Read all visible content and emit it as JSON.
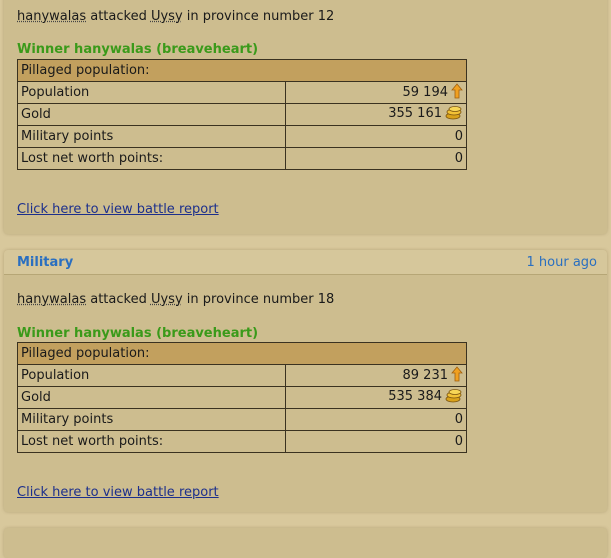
{
  "reports": [
    {
      "category": "",
      "time": "",
      "attacker": "hanywalas",
      "verb": "attacked",
      "defender": "Uysy",
      "province_text": "in province number 12",
      "winner": "Winner hanywalas (breaveheart)",
      "table_header": "Pillaged population:",
      "rows": [
        {
          "label": "Population",
          "value": "59 194",
          "icon": "population-arrow-icon"
        },
        {
          "label": "Gold",
          "value": "355 161",
          "icon": "gold-coins-icon"
        },
        {
          "label": "Military points",
          "value": "0"
        },
        {
          "label": "Lost net worth points:",
          "value": "0"
        }
      ],
      "link": "Click here to view battle report"
    },
    {
      "category": "Military",
      "time": "1 hour ago",
      "attacker": "hanywalas",
      "verb": "attacked",
      "defender": "Uysy",
      "province_text": "in province number 18",
      "winner": "Winner hanywalas (breaveheart)",
      "table_header": "Pillaged population:",
      "rows": [
        {
          "label": "Population",
          "value": "89 231",
          "icon": "population-arrow-icon"
        },
        {
          "label": "Gold",
          "value": "535 384",
          "icon": "gold-coins-icon"
        },
        {
          "label": "Military points",
          "value": "0"
        },
        {
          "label": "Lost net worth points:",
          "value": "0"
        }
      ],
      "link": "Click here to view battle report"
    }
  ],
  "colors": {
    "winner": "#3a9a1a",
    "category": "#2a6fc0",
    "link": "#1c2f8c",
    "table_header": "#c2a05e"
  }
}
